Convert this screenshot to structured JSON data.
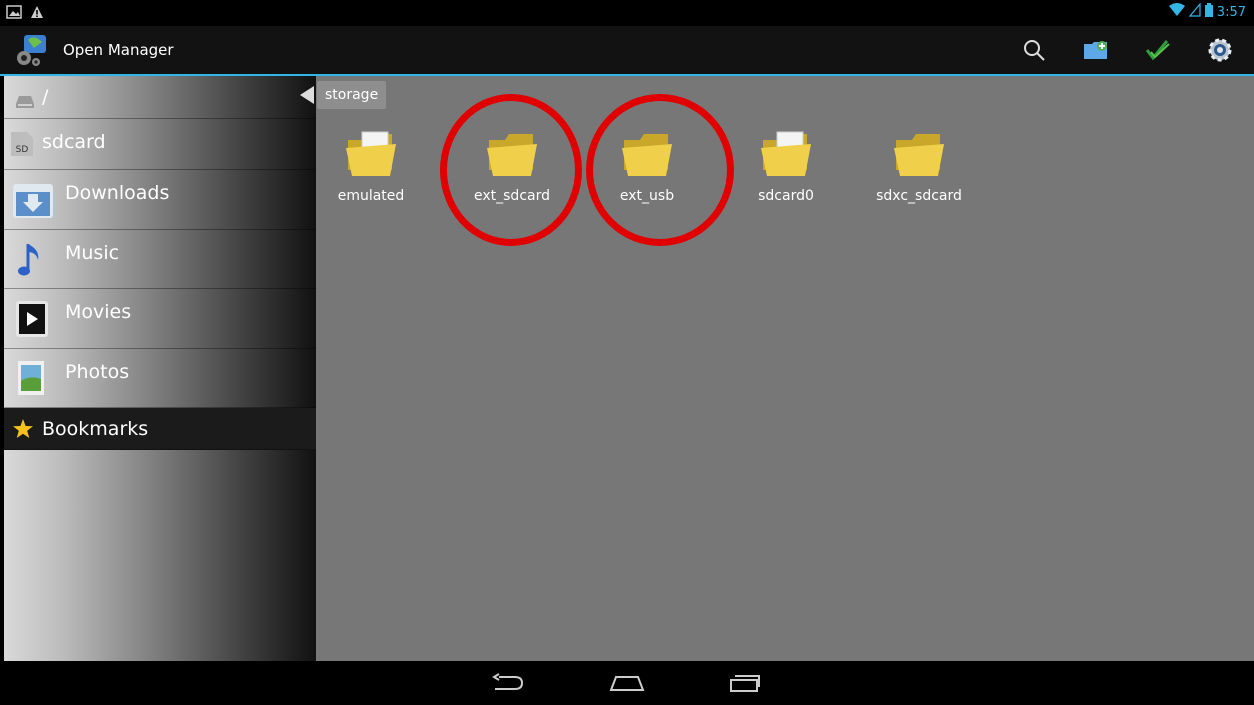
{
  "status_bar": {
    "time": "3:57"
  },
  "app": {
    "title": "Open Manager"
  },
  "sidebar": {
    "root_label": "/",
    "sdcard_label": "sdcard",
    "sd_badge": "SD",
    "items": [
      {
        "label": "Downloads",
        "icon": "downloads-icon"
      },
      {
        "label": "Music",
        "icon": "music-icon"
      },
      {
        "label": "Movies",
        "icon": "movies-icon"
      },
      {
        "label": "Photos",
        "icon": "photos-icon"
      }
    ],
    "bookmarks_label": "Bookmarks"
  },
  "breadcrumb": {
    "current": "storage"
  },
  "folders": [
    {
      "name": "emulated",
      "has_files": true
    },
    {
      "name": "ext_sdcard",
      "has_files": false,
      "highlighted": true
    },
    {
      "name": "ext_usb",
      "has_files": false,
      "highlighted": true
    },
    {
      "name": "sdcard0",
      "has_files": true
    },
    {
      "name": "sdxc_sdcard",
      "has_files": false
    }
  ],
  "colors": {
    "accent": "#33b5e5",
    "highlight_circle": "#e00000",
    "folder": "#f0cf4a"
  }
}
